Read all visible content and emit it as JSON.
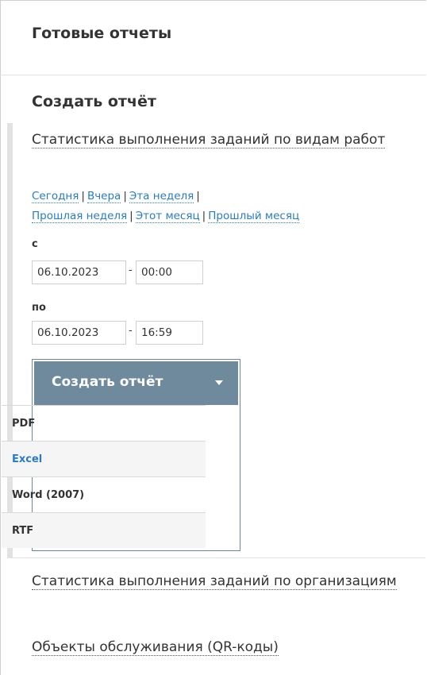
{
  "ready_reports": {
    "title": "Готовые отчеты"
  },
  "create_report": {
    "title": "Создать отчёт",
    "reports": [
      "Статистика выполнения заданий по видам работ",
      "Статистика выполнения заданий по организациям",
      "Объекты обслуживания (QR-коды)"
    ],
    "quick_ranges": {
      "today": "Сегодня",
      "yesterday": "Вчера",
      "this_week": "Эта неделя",
      "last_week": "Прошлая неделя",
      "this_month": "Этот месяц",
      "last_month": "Прошлый месяц"
    },
    "from": {
      "label": "с",
      "date": "06.10.2023",
      "time": "00:00"
    },
    "to": {
      "label": "по",
      "date": "06.10.2023",
      "time": "16:59"
    },
    "dropdown": {
      "label": "Создать отчёт",
      "options": [
        "PDF",
        "Excel",
        "Word (2007)",
        "RTF"
      ],
      "highlighted": "Excel"
    }
  },
  "colors": {
    "accent_button": "#6f8a9c",
    "link": "#2a7bc6",
    "text": "#333333"
  },
  "icons": {
    "dropdown_caret": "caret-down-icon"
  }
}
